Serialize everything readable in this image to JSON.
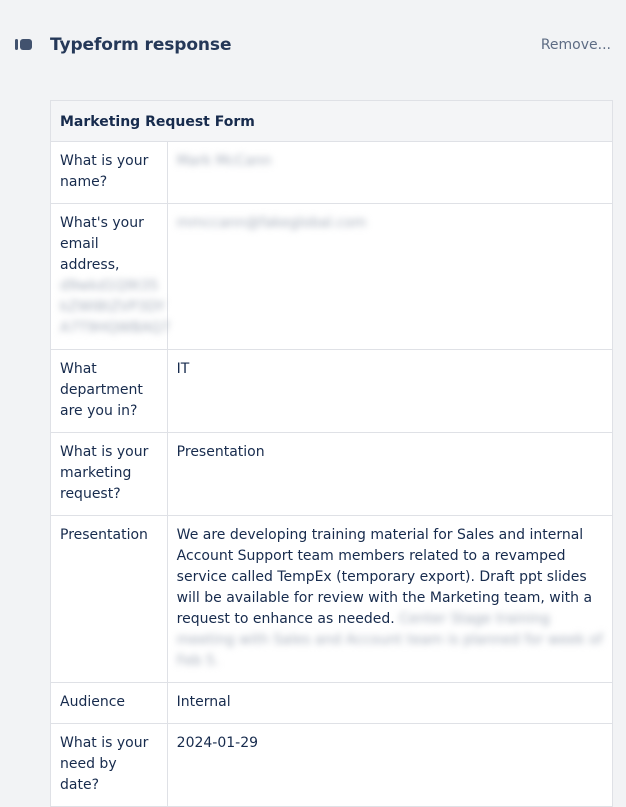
{
  "header": {
    "icon": "toggle-pill-icon",
    "title": "Typeform response",
    "remove_label": "Remove..."
  },
  "form": {
    "title": "Marketing Request Form",
    "rows": [
      {
        "question": "What is your name?",
        "answer": "Mark McCann",
        "answer_redacted": true
      },
      {
        "question": "What's your email address,",
        "question_redacted_suffix": "d9wkd1Q9t35 kZWI8tZVP3DY A7T9HQWBAQ7",
        "answer": "mmccann@fakeglobal.com",
        "answer_redacted": true
      },
      {
        "question": "What department are you in?",
        "answer": "IT"
      },
      {
        "question": "What is your marketing request?",
        "answer": "Presentation"
      },
      {
        "question": "Presentation",
        "answer": "We are developing training material for Sales and internal Account Support team members related to a revamped service called TempEx (temporary export). Draft ppt slides will be available for review with the Marketing team, with a request to enhance as needed.",
        "answer_redacted_suffix": "Center Stage training meeting with Sales and Account team is planned for week of Feb 5."
      },
      {
        "question": "Audience",
        "answer": "Internal"
      },
      {
        "question": "What is your need by date?",
        "answer": "2024-01-29"
      }
    ]
  },
  "colors": {
    "background": "#f2f3f5",
    "border": "#dfe1e6",
    "text": "#172b4d",
    "muted": "#5e6c84"
  }
}
